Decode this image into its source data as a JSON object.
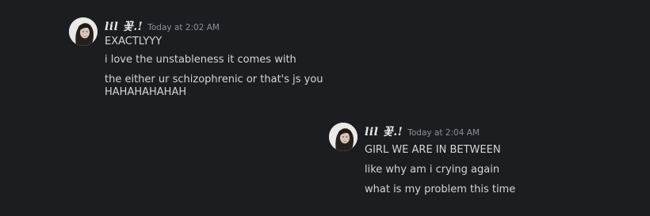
{
  "messages": [
    {
      "username": "lil 꽃.!",
      "timestamp": "Today at 2:02 AM",
      "lines": [
        "EXACTLYYY",
        "i love the unstableness it comes with",
        "the either ur schizophrenic or that's js you",
        "HAHAHAHAHAH"
      ]
    },
    {
      "username": "lil 꽃.!",
      "timestamp": "Today at 2:04 AM",
      "lines": [
        "GIRL WE ARE IN BETWEEN",
        "like why am i crying again",
        "what is my problem this time"
      ]
    }
  ]
}
